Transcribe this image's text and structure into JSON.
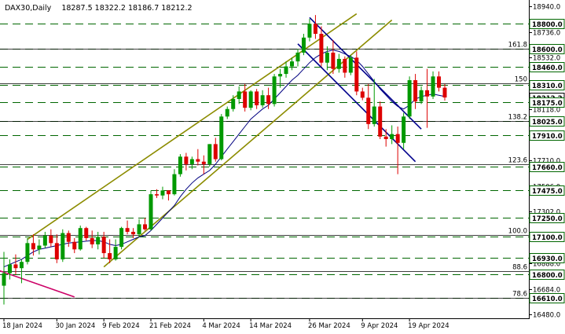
{
  "chart_data": {
    "type": "candlestick",
    "header": {
      "symbol_tf": "DAX30,Daily",
      "ohlc": "18287.5 18322.2 18186.7 18212.2"
    },
    "ylim": [
      16450,
      18990
    ],
    "y_ticks": [
      {
        "value": 18940,
        "label": "18940.0"
      },
      {
        "value": 18736,
        "label": "18736.0"
      },
      {
        "value": 18532,
        "label": "18532.0"
      },
      {
        "value": 18118,
        "label": "18118.0"
      },
      {
        "value": 17710,
        "label": "17710.0"
      },
      {
        "value": 17506,
        "label": "17506.0"
      },
      {
        "value": 17302,
        "label": "17302.0"
      },
      {
        "value": 17098,
        "label": "17098.0"
      },
      {
        "value": 16888,
        "label": "16888.0"
      },
      {
        "value": 16684,
        "label": "16684.0"
      },
      {
        "value": 16480,
        "label": "16480.0"
      }
    ],
    "price_tag": {
      "value": 18212.2,
      "label": "18212.2"
    },
    "levels": [
      {
        "value": 18800,
        "label": "18800.0"
      },
      {
        "value": 18600,
        "label": "18600.0"
      },
      {
        "value": 18460,
        "label": "18460.0"
      },
      {
        "value": 18310,
        "label": "18310.0"
      },
      {
        "value": 18175,
        "label": "18175.0"
      },
      {
        "value": 18025,
        "label": "18025.0"
      },
      {
        "value": 17910,
        "label": "17910.0"
      },
      {
        "value": 17660,
        "label": "17660.0"
      },
      {
        "value": 17475,
        "label": "17475.0"
      },
      {
        "value": 17250,
        "label": "17250.0"
      },
      {
        "value": 17100,
        "label": "17100.0"
      },
      {
        "value": 16930,
        "label": "16930.0"
      },
      {
        "value": 16800,
        "label": "16800.0"
      },
      {
        "value": 16610,
        "label": "16610.0"
      }
    ],
    "fib_levels": [
      {
        "label": "161.8",
        "value": 18600
      },
      {
        "label": "150",
        "value": 18325
      },
      {
        "label": "138.2",
        "value": 18025
      },
      {
        "label": "123.6",
        "value": 17680
      },
      {
        "label": "100.0",
        "value": 17115
      },
      {
        "label": "88.6",
        "value": 16825
      },
      {
        "label": "78.6",
        "value": 16610
      }
    ],
    "x_labels": [
      {
        "index": 0,
        "label": "18 Jan 2024"
      },
      {
        "index": 9,
        "label": "30 Jan 2024"
      },
      {
        "index": 17,
        "label": "9 Feb 2024"
      },
      {
        "index": 25,
        "label": "21 Feb 2024"
      },
      {
        "index": 34,
        "label": "4 Mar 2024"
      },
      {
        "index": 42,
        "label": "14 Mar 2024"
      },
      {
        "index": 52,
        "label": "26 Mar 2024"
      },
      {
        "index": 61,
        "label": "9 Apr 2024"
      },
      {
        "index": 69,
        "label": "19 Apr 2024"
      }
    ],
    "candles": [
      [
        16710,
        16980,
        16560,
        16810
      ],
      [
        16810,
        16920,
        16760,
        16880
      ],
      [
        16880,
        16960,
        16800,
        16850
      ],
      [
        16850,
        16920,
        16730,
        16900
      ],
      [
        16900,
        17090,
        16880,
        17050
      ],
      [
        17050,
        17120,
        16950,
        17000
      ],
      [
        17000,
        17080,
        16960,
        17030
      ],
      [
        17030,
        17140,
        17010,
        17110
      ],
      [
        17110,
        17160,
        17020,
        17050
      ],
      [
        17050,
        17120,
        16890,
        16920
      ],
      [
        16920,
        17160,
        16900,
        17130
      ],
      [
        17130,
        17150,
        17020,
        17060
      ],
      [
        17060,
        17090,
        16970,
        17000
      ],
      [
        17000,
        17190,
        16990,
        17170
      ],
      [
        17170,
        17180,
        17070,
        17090
      ],
      [
        17090,
        17150,
        17010,
        17040
      ],
      [
        17040,
        17140,
        17000,
        17100
      ],
      [
        17100,
        17140,
        16930,
        16970
      ],
      [
        16970,
        17080,
        16890,
        16920
      ],
      [
        16920,
        17080,
        16910,
        17020
      ],
      [
        17020,
        17180,
        17000,
        17170
      ],
      [
        17170,
        17230,
        17120,
        17140
      ],
      [
        17140,
        17170,
        17090,
        17120
      ],
      [
        17120,
        17240,
        17100,
        17200
      ],
      [
        17200,
        17250,
        17150,
        17160
      ],
      [
        17160,
        17470,
        17150,
        17440
      ],
      [
        17440,
        17480,
        17410,
        17430
      ],
      [
        17430,
        17500,
        17400,
        17470
      ],
      [
        17470,
        17470,
        17390,
        17440
      ],
      [
        17440,
        17640,
        17430,
        17600
      ],
      [
        17600,
        17760,
        17580,
        17740
      ],
      [
        17740,
        17770,
        17630,
        17680
      ],
      [
        17680,
        17740,
        17640,
        17720
      ],
      [
        17720,
        17800,
        17670,
        17700
      ],
      [
        17700,
        17750,
        17600,
        17680
      ],
      [
        17680,
        17840,
        17660,
        17840
      ],
      [
        17840,
        17890,
        17700,
        17720
      ],
      [
        17720,
        18080,
        17710,
        18060
      ],
      [
        18060,
        18140,
        18040,
        18120
      ],
      [
        18120,
        18230,
        18100,
        18200
      ],
      [
        18200,
        18300,
        18160,
        18260
      ],
      [
        18260,
        18320,
        18100,
        18130
      ],
      [
        18130,
        18270,
        18110,
        18260
      ],
      [
        18260,
        18280,
        18120,
        18150
      ],
      [
        18150,
        18270,
        18130,
        18230
      ],
      [
        18230,
        18290,
        18120,
        18160
      ],
      [
        18160,
        18400,
        18140,
        18380
      ],
      [
        18380,
        18440,
        18290,
        18400
      ],
      [
        18400,
        18500,
        18370,
        18460
      ],
      [
        18460,
        18530,
        18430,
        18500
      ],
      [
        18500,
        18600,
        18460,
        18570
      ],
      [
        18570,
        18720,
        18550,
        18690
      ],
      [
        18690,
        18840,
        18660,
        18800
      ],
      [
        18800,
        18870,
        18680,
        18720
      ],
      [
        18720,
        18780,
        18460,
        18490
      ],
      [
        18490,
        18620,
        18430,
        18570
      ],
      [
        18570,
        18670,
        18400,
        18440
      ],
      [
        18440,
        18560,
        18410,
        18520
      ],
      [
        18520,
        18540,
        18370,
        18410
      ],
      [
        18410,
        18550,
        18390,
        18530
      ],
      [
        18530,
        18580,
        18230,
        18260
      ],
      [
        18260,
        18290,
        18190,
        18210
      ],
      [
        18210,
        18320,
        17960,
        18000
      ],
      [
        18000,
        18360,
        17980,
        18140
      ],
      [
        18140,
        18180,
        17880,
        17900
      ],
      [
        17900,
        17960,
        17820,
        17880
      ],
      [
        17880,
        17990,
        17840,
        17920
      ],
      [
        17920,
        17980,
        17600,
        17850
      ],
      [
        17850,
        18090,
        17800,
        18060
      ],
      [
        18060,
        18380,
        18040,
        18350
      ],
      [
        18350,
        18400,
        18120,
        18180
      ],
      [
        18180,
        18300,
        18160,
        18270
      ],
      [
        18270,
        18440,
        17970,
        18220
      ],
      [
        18220,
        18420,
        18200,
        18380
      ],
      [
        18380,
        18420,
        18260,
        18290
      ],
      [
        18290,
        18320,
        18187,
        18212
      ]
    ],
    "ma": [
      16860,
      16880,
      16900,
      16920,
      16950,
      16980,
      17000,
      17010,
      17020,
      17030,
      17040,
      17050,
      17055,
      17060,
      17065,
      17070,
      17070,
      17060,
      17040,
      17030,
      17040,
      17060,
      17080,
      17100,
      17110,
      17150,
      17200,
      17250,
      17300,
      17350,
      17420,
      17480,
      17530,
      17570,
      17600,
      17630,
      17680,
      17740,
      17800,
      17860,
      17920,
      17980,
      18040,
      18080,
      18120,
      18150,
      18200,
      18250,
      18300,
      18350,
      18390,
      18440,
      18490,
      18530,
      18560,
      18580,
      18590,
      18580,
      18560,
      18540,
      18510,
      18460,
      18400,
      18340,
      18280,
      18230,
      18180,
      18140,
      18120,
      18150,
      18200,
      18220,
      18230,
      18240,
      18230,
      18220
    ],
    "channels": [
      {
        "name": "up-upper",
        "color": "#8c8c00",
        "start": [
          4,
          17080
        ],
        "end": [
          60,
          18880
        ]
      },
      {
        "name": "up-lower",
        "color": "#8c8c00",
        "start": [
          17,
          16860
        ],
        "end": [
          66,
          18830
        ]
      },
      {
        "name": "down-upper",
        "color": "#00008c",
        "start": [
          52,
          18850
        ],
        "end": [
          71,
          17960
        ]
      },
      {
        "name": "down-lower",
        "color": "#00008c",
        "start": [
          50,
          18640
        ],
        "end": [
          70,
          17700
        ]
      },
      {
        "name": "magenta",
        "color": "#cc0066",
        "start": [
          -2,
          16850
        ],
        "end": [
          12,
          16620
        ]
      }
    ],
    "colors": {
      "bull": "#009900",
      "bear": "#dd0000",
      "ma": "#000080",
      "level_line": "#006600",
      "fib_line": "#000000",
      "label_bg": "#ffffff"
    }
  }
}
